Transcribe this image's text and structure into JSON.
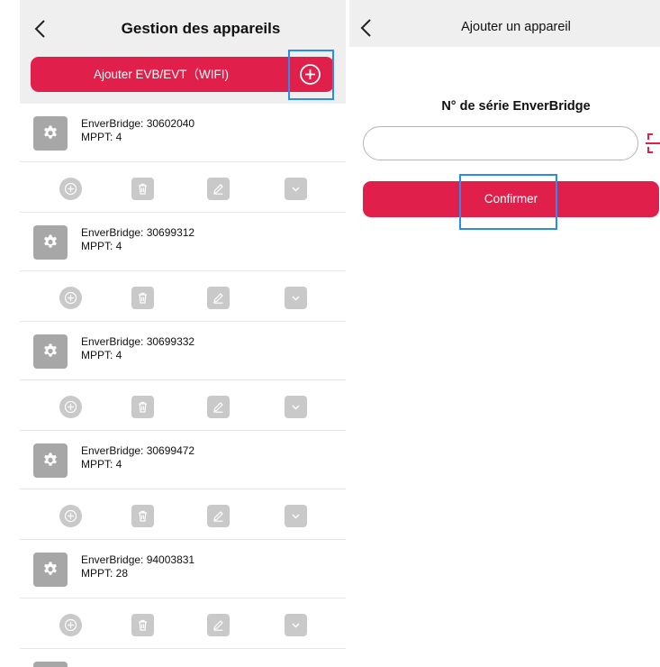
{
  "left_screen": {
    "title": "Gestion des appareils",
    "add_button_label": "Ajouter EVB/EVT（WIFI)",
    "devices": [
      {
        "serial_label": "EnverBridge: 30602040",
        "mppt_label": "MPPT: 4"
      },
      {
        "serial_label": "EnverBridge: 30699312",
        "mppt_label": "MPPT: 4"
      },
      {
        "serial_label": "EnverBridge: 30699332",
        "mppt_label": "MPPT: 4"
      },
      {
        "serial_label": "EnverBridge: 30699472",
        "mppt_label": "MPPT: 4"
      },
      {
        "serial_label": "EnverBridge: 94003831",
        "mppt_label": "MPPT: 28"
      }
    ],
    "device_actions": [
      "plus-circle-icon",
      "trash-icon",
      "pencil-icon",
      "chevron-down-icon"
    ],
    "highlighted_element": "add-device-plus-button"
  },
  "right_screen": {
    "title": "Ajouter un appareil",
    "field_label": "N° de série EnverBridge",
    "serial_input": {
      "value": "",
      "placeholder": ""
    },
    "confirm_label": "Confirmer",
    "highlighted_element": "confirm-button"
  },
  "colors": {
    "accent": "#e0204a",
    "header_bg": "#efefef",
    "icon_gray": "#c9c9c9",
    "gear_box_gray": "#a7a7a7",
    "highlight_box": "#2a8cf0"
  }
}
